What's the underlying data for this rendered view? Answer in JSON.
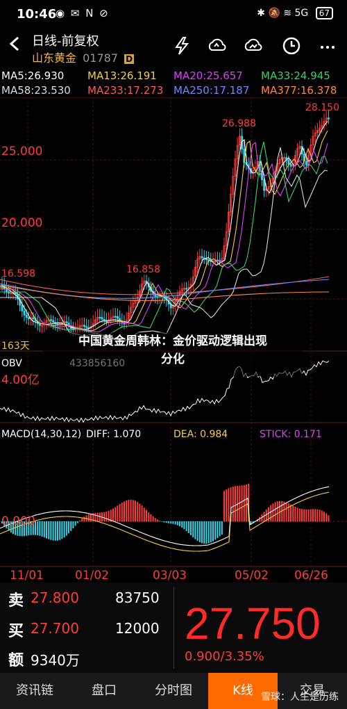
{
  "status_bar": {
    "time": "10:46",
    "icons": "◉ ✉ N ⊘",
    "signals": "✱ 🔕 ≋ 5G",
    "battery": "67"
  },
  "header": {
    "title": "日线-前复权",
    "stock_name": "山东黄金",
    "stock_code": "01787",
    "badge": "D",
    "icons": [
      "lightning-icon",
      "cloud-refresh-icon",
      "cloud-chart-icon",
      "clock-icon",
      "more-icon"
    ]
  },
  "ma": {
    "ma5": "MA5:26.930",
    "ma13": "MA13:26.191",
    "ma20": "MA20:25.657",
    "ma33": "MA33:24.945",
    "ma58": "MA58:23.530",
    "ma233": "MA233:17.273",
    "ma250": "MA250:17.187",
    "ma377": "MA377:16.378",
    "colors": {
      "ma5": "#ffffff",
      "ma13": "#f5d040",
      "ma20": "#e040fb",
      "ma33": "#36d36a",
      "ma58": "#dddddd",
      "ma233": "#ff5a5a",
      "ma250": "#6a8cff",
      "ma377": "#ff8a3c"
    }
  },
  "price_chart": {
    "y_labels": [
      "25.000",
      "20.000"
    ],
    "annotations": [
      "28.150",
      "26.988",
      "16.858",
      "16.598"
    ],
    "period_label": "163天",
    "up_color": "#ff3b3b",
    "down_color": "#33d4e8"
  },
  "obv": {
    "label": "OBV",
    "value": "433856160",
    "scale": "4.00亿"
  },
  "macd": {
    "label": "MACD(14,30,12)",
    "diff": "DIFF: 1.070",
    "dea": "DEA: 0.984",
    "stick": "STICK: 0.171",
    "zero": "0.000",
    "colors": {
      "diff": "#ffffff",
      "dea": "#f5d040",
      "stick": "#e040fb"
    }
  },
  "x_axis": [
    "11/01",
    "01/02",
    "03/03",
    "05/02",
    "06/26"
  ],
  "headline": {
    "line1": "中国黄金周韩林：金价驱动逻辑出现",
    "line2": "分化"
  },
  "quote": {
    "sell_label": "卖",
    "sell_price": "27.800",
    "sell_vol": "83750",
    "buy_label": "买",
    "buy_price": "27.700",
    "buy_vol": "12000",
    "amount_label": "额",
    "amount_value": "9340万",
    "last_price": "27.750",
    "change": "0.900/3.35%"
  },
  "tabs": [
    {
      "label": "资讯链",
      "active": false
    },
    {
      "label": "盘口",
      "active": false
    },
    {
      "label": "分时图",
      "active": false
    },
    {
      "label": "K线",
      "active": true
    },
    {
      "label": "交易",
      "active": false
    }
  ],
  "watermark": "雪球：人生是历练"
}
